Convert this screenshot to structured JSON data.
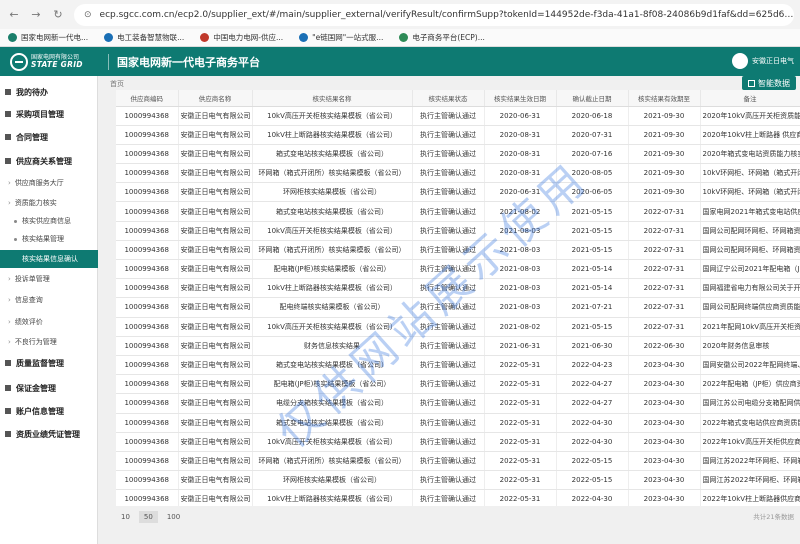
{
  "browser": {
    "url": "ecp.sgcc.com.cn/ecp2.0/supplier_ext/#/main/supplier_external/verifyResult/confirmSupp?tokenId=144952de-f3da-41a1-8f08-24086b9d1faf&dd=625d61d...",
    "bookmarks": [
      {
        "label": "国家电网新一代电...",
        "color": "#1b7f6b"
      },
      {
        "label": "电工装备智慧物联...",
        "color": "#1a6fb5"
      },
      {
        "label": "中国电力电网-供应...",
        "color": "#c0392b"
      },
      {
        "label": "\"e链国网\"一站式服...",
        "color": "#1a6fb5"
      },
      {
        "label": "电子商务平台(ECP)...",
        "color": "#2e8b57"
      }
    ]
  },
  "header": {
    "logo_cn": "国家电网有限公司",
    "logo_en": "STATE GRID",
    "title": "国家电网新一代电子商务平台",
    "user": "安徽正日电气"
  },
  "sidebar": {
    "items": [
      {
        "label": "我的待办",
        "kind": "main"
      },
      {
        "label": "采购项目管理",
        "kind": "main"
      },
      {
        "label": "合同管理",
        "kind": "main"
      },
      {
        "label": "供应商关系管理",
        "kind": "main"
      },
      {
        "label": "供应商服务大厅",
        "kind": "sub"
      },
      {
        "label": "资质能力核实",
        "kind": "sub"
      },
      {
        "label": "核实供应商信息",
        "kind": "sub2"
      },
      {
        "label": "核实结果管理",
        "kind": "sub2"
      },
      {
        "label": "核实结果信息确认",
        "kind": "active"
      },
      {
        "label": "投诉单管理",
        "kind": "sub"
      },
      {
        "label": "信息查询",
        "kind": "sub"
      },
      {
        "label": "绩效评价",
        "kind": "sub"
      },
      {
        "label": "不良行为管理",
        "kind": "sub"
      },
      {
        "label": "质量监督管理",
        "kind": "main"
      },
      {
        "label": "保证金管理",
        "kind": "main"
      },
      {
        "label": "账户信息管理",
        "kind": "main"
      },
      {
        "label": "资质业绩凭证管理",
        "kind": "main"
      }
    ]
  },
  "content": {
    "breadcrumb": "首页",
    "export_label": "智能数据",
    "columns": [
      "供应商编码",
      "供应商名称",
      "核实结果名称",
      "核实结果状态",
      "核实结果生效日期",
      "确认截止日期",
      "核实结果有效期至",
      "备注"
    ],
    "rows": [
      [
        "1000994368",
        "安徽正日电气有限公司",
        "10kV高压开关柜核实结果模板（省公司）",
        "执行主管确认通过",
        "2020-06-31",
        "2020-06-18",
        "2021-09-30",
        "2020年10kV高压开关柜资质能力"
      ],
      [
        "1000994368",
        "安徽正日电气有限公司",
        "10kV柱上断路器核实结果模板（省公司）",
        "执行主管确认通过",
        "2020-08-31",
        "2020-07-31",
        "2021-09-30",
        "2020年10kV柱上断路器 供应商资"
      ],
      [
        "1000994368",
        "安徽正日电气有限公司",
        "箱式变电站核实结果模板（省公司）",
        "执行主管确认通过",
        "2020-08-31",
        "2020-07-16",
        "2021-09-30",
        "2020年箱式变电站资质能力核实"
      ],
      [
        "1000994368",
        "安徽正日电气有限公司",
        "环网箱（箱式开闭所）核实结果模板（省公司）",
        "执行主管确认通过",
        "2020-08-31",
        "2020-08-05",
        "2021-09-30",
        "10kV环网柜、环网箱（箱式开闭"
      ],
      [
        "1000994368",
        "安徽正日电气有限公司",
        "环网柜核实结果模板（省公司）",
        "执行主管确认通过",
        "2020-06-31",
        "2020-06-05",
        "2021-09-30",
        "10kV环网柜、环网箱（箱式开闭"
      ],
      [
        "1000994368",
        "安徽正日电气有限公司",
        "箱式变电站核实结果模板（省公司）",
        "执行主管确认通过",
        "2021-08-02",
        "2021-05-15",
        "2022-07-31",
        "国家电网2021年箱式变电站供应商"
      ],
      [
        "1000994368",
        "安徽正日电气有限公司",
        "10kV高压开关柜核实结果模板（省公司）",
        "执行主管确认通过",
        "2021-08-03",
        "2021-05-15",
        "2022-07-31",
        "国网公司配网环网柜、环网箱资质"
      ],
      [
        "1000994368",
        "安徽正日电气有限公司",
        "环网箱（箱式开闭所）核实结果模板（省公司）",
        "执行主管确认通过",
        "2021-08-03",
        "2021-05-15",
        "2022-07-31",
        "国网公司配网环网柜、环网箱资质"
      ],
      [
        "1000994368",
        "安徽正日电气有限公司",
        "配电箱(JP柜)核实结果模板（省公司）",
        "执行主管确认通过",
        "2021-08-03",
        "2021-05-14",
        "2022-07-31",
        "国网辽宁公司2021年配电箱（JP柜"
      ],
      [
        "1000994368",
        "安徽正日电气有限公司",
        "10kV柱上断路器核实结果模板（省公司）",
        "执行主管确认通过",
        "2021-08-03",
        "2021-05-14",
        "2022-07-31",
        "国网福建省电力有限公司关于开展"
      ],
      [
        "1000994368",
        "安徽正日电气有限公司",
        "配电终端核实结果模板（省公司）",
        "执行主管确认通过",
        "2021-08-03",
        "2021-07-21",
        "2022-07-31",
        "国网公司配网终端供应商资质能力"
      ],
      [
        "1000994368",
        "安徽正日电气有限公司",
        "10kV高压开关柜核实结果模板（省公司）",
        "执行主管确认通过",
        "2021-08-02",
        "2021-05-15",
        "2022-07-31",
        "2021年配网10kV高压开关柜资质能"
      ],
      [
        "1000994368",
        "安徽正日电气有限公司",
        "财务信息核实结果",
        "执行主管确认通过",
        "2021-06-31",
        "2021-06-30",
        "2022-06-30",
        "2020年财务信息审核"
      ],
      [
        "1000994368",
        "安徽正日电气有限公司",
        "箱式变电站核实结果模板（省公司）",
        "执行主管确认通过",
        "2022-05-31",
        "2022-04-23",
        "2023-04-30",
        "国网安徽公司2022年配网终端、箱"
      ],
      [
        "1000994368",
        "安徽正日电气有限公司",
        "配电箱(JP柜)核实结果模板（省公司）",
        "执行主管确认通过",
        "2022-05-31",
        "2022-04-27",
        "2023-04-30",
        "2022年配电箱（JP柜）供应商资质"
      ],
      [
        "1000994368",
        "安徽正日电气有限公司",
        "电缆分支箱核实结果模板（省公司）",
        "执行主管确认通过",
        "2022-05-31",
        "2022-04-27",
        "2023-04-30",
        "国网江苏公司电缆分支箱配网供应"
      ],
      [
        "1000994368",
        "安徽正日电气有限公司",
        "箱式变电站核实结果模板（省公司）",
        "执行主管确认通过",
        "2022-05-31",
        "2022-04-30",
        "2023-04-30",
        "2022年箱式变电站供应商资质能力"
      ],
      [
        "1000994368",
        "安徽正日电气有限公司",
        "10kV高压开关柜核实结果模板（省公司）",
        "执行主管确认通过",
        "2022-05-31",
        "2022-04-30",
        "2023-04-30",
        "2022年10kV高压开关柜供应商资质"
      ],
      [
        "1000994368",
        "安徽正日电气有限公司",
        "环网箱（箱式开闭所）核实结果模板（省公司）",
        "执行主管确认通过",
        "2022-05-31",
        "2022-05-15",
        "2023-04-30",
        "国网江苏2022年环网柜、环网箱"
      ],
      [
        "1000994368",
        "安徽正日电气有限公司",
        "环网柜核实结果模板（省公司）",
        "执行主管确认通过",
        "2022-05-31",
        "2022-05-15",
        "2023-04-30",
        "国网江苏2022年环网柜、环网箱"
      ],
      [
        "1000994368",
        "安徽正日电气有限公司",
        "10kV柱上断路器核实结果模板（省公司）",
        "执行主管确认通过",
        "2022-05-31",
        "2022-04-30",
        "2023-04-30",
        "2022年10kV柱上断路器供应商资质"
      ]
    ],
    "page_sizes": [
      "10",
      "50",
      "100"
    ],
    "active_page_size": "50",
    "pager_info": "共计21条数据"
  },
  "watermark": "仅供网站展示使用"
}
